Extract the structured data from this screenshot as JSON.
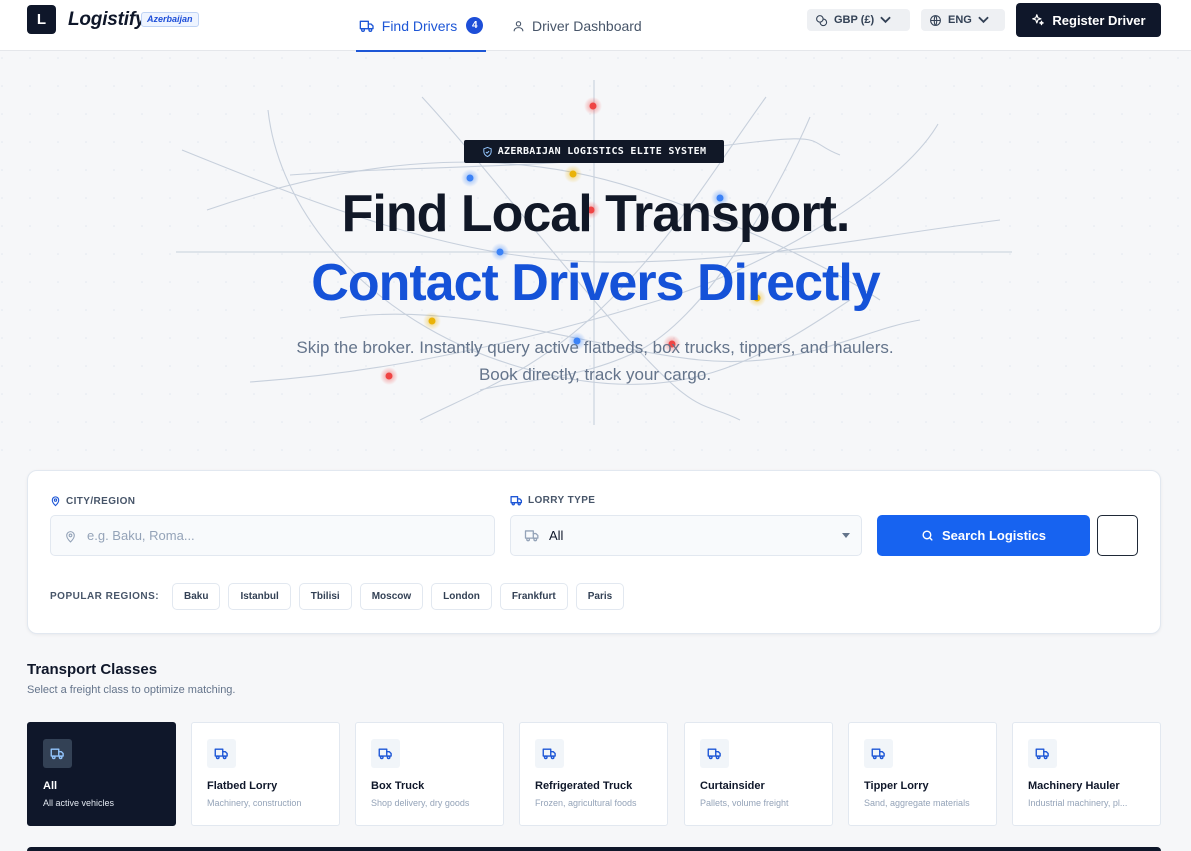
{
  "nav": {
    "logo_letter": "L",
    "brand": "Logistify",
    "region_tag": "Azerbaijan",
    "tabs": [
      {
        "label": "Find Drivers",
        "badge": "4",
        "active": true
      },
      {
        "label": "Driver Dashboard",
        "active": false
      }
    ],
    "currency": "GBP (£)",
    "language": "ENG",
    "register_label": "Register Driver"
  },
  "hero": {
    "badge": "AZERBAIJAN LOGISTICS ELITE SYSTEM",
    "title_line1": "Find Local Transport.",
    "title_line2": "Contact Drivers Directly",
    "subtitle": "Skip the broker. Instantly query active flatbeds, box trucks, tippers, and haulers. Book directly, track your cargo."
  },
  "search": {
    "city_label": "CITY/REGION",
    "city_placeholder": "e.g. Baku, Roma...",
    "city_value": "",
    "lorry_label": "LORRY TYPE",
    "lorry_value": "All",
    "search_label": "Search Logistics",
    "popular_label": "POPULAR REGIONS:",
    "popular_regions": [
      "Baku",
      "Istanbul",
      "Tbilisi",
      "Moscow",
      "London",
      "Frankfurt",
      "Paris"
    ]
  },
  "classes": {
    "title": "Transport Classes",
    "subtitle": "Select a freight class to optimize matching.",
    "items": [
      {
        "name": "All",
        "desc": "All active vehicles",
        "active": true
      },
      {
        "name": "Flatbed Lorry",
        "desc": "Machinery, construction",
        "active": false
      },
      {
        "name": "Box Truck",
        "desc": "Shop delivery, dry goods",
        "active": false
      },
      {
        "name": "Refrigerated Truck",
        "desc": "Frozen, agricultural foods",
        "active": false
      },
      {
        "name": "Curtainsider",
        "desc": "Pallets, volume freight",
        "active": false
      },
      {
        "name": "Tipper Lorry",
        "desc": "Sand, aggregate materials",
        "active": false
      },
      {
        "name": "Machinery Hauler",
        "desc": "Industrial machinery, pl...",
        "active": false
      }
    ]
  },
  "colors": {
    "accent": "#1763f0",
    "brand_dark": "#0f172a",
    "title_blue": "#1552d8",
    "map_dot_red": "#ef4444",
    "map_dot_blue": "#3b82f6",
    "map_dot_yellow": "#eab308"
  },
  "icons": {
    "truck": "truck-icon",
    "user": "user-icon",
    "coins": "coins-icon",
    "globe": "globe-icon",
    "sparkles": "sparkles-icon",
    "shield": "shield-icon",
    "map_pin": "map-pin-icon",
    "search": "search-icon"
  }
}
